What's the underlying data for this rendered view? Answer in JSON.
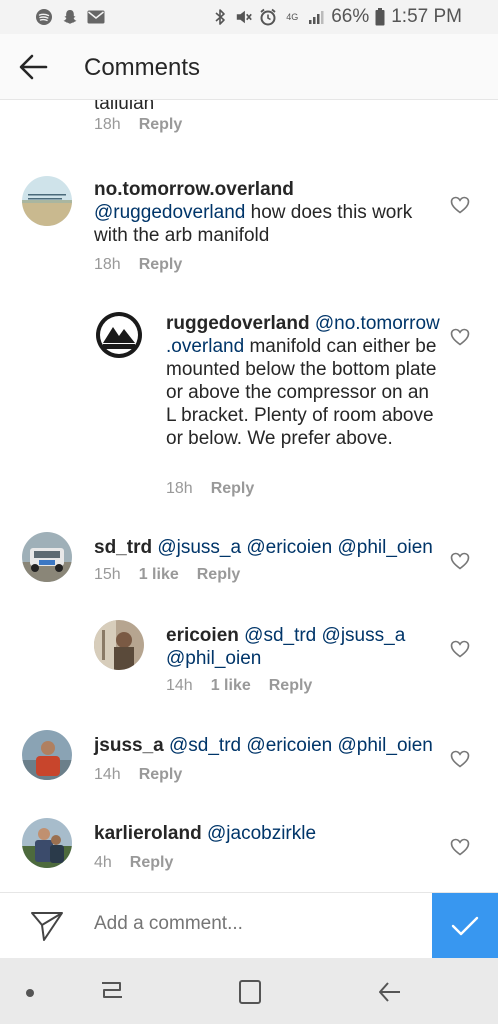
{
  "status_bar": {
    "battery_percent": "66%",
    "time": "1:57 PM",
    "network_label": "4G",
    "left_icons": [
      "spotify-icon",
      "snapchat-icon",
      "mail-icon"
    ],
    "right_icons": [
      "bluetooth-icon",
      "mute-icon",
      "alarm-icon",
      "signal-icon",
      "battery-icon"
    ]
  },
  "header": {
    "title": "Comments"
  },
  "comments": [
    {
      "partial_text": "tallulah",
      "time": "18h",
      "reply_label": "Reply"
    },
    {
      "username": "no.tomorrow.overland",
      "mention": "@ruggedoverland",
      "text": " how does this work with the arb manifold",
      "time": "18h",
      "reply_label": "Reply"
    },
    {
      "username": "ruggedoverland",
      "mention": "@no.tomorrow .overland",
      "text": " manifold can either be mounted below the bottom plate or above the compressor on an L bracket. Plenty of room above or below. We prefer above.",
      "time": "18h",
      "reply_label": "Reply"
    },
    {
      "username": "sd_trd",
      "mentions": [
        "@jsuss_a",
        "@ericoien",
        "@phil_oien"
      ],
      "time": "15h",
      "likes": "1 like",
      "reply_label": "Reply"
    },
    {
      "username": "ericoien",
      "mentions": [
        "@sd_trd",
        "@jsuss_a",
        "@phil_oien"
      ],
      "time": "14h",
      "likes": "1 like",
      "reply_label": "Reply"
    },
    {
      "username": "jsuss_a",
      "mentions": [
        "@sd_trd",
        "@ericoien",
        "@phil_oien"
      ],
      "time": "14h",
      "reply_label": "Reply"
    },
    {
      "username": "karlieroland",
      "mentions": [
        "@jacobzirkle"
      ],
      "time": "4h",
      "reply_label": "Reply"
    }
  ],
  "composer": {
    "placeholder": "Add a comment..."
  },
  "colors": {
    "accent": "#3897f0",
    "mention": "#003569"
  }
}
